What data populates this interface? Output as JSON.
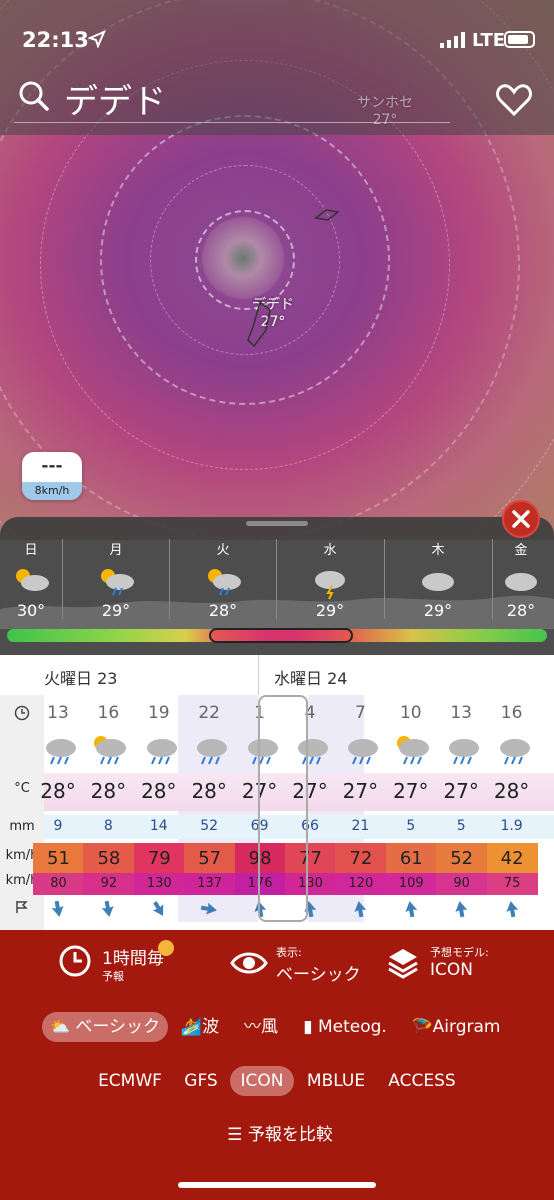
{
  "status": {
    "time": "22:13",
    "network": "LTE"
  },
  "search": {
    "title": "デデド"
  },
  "map": {
    "labels": [
      {
        "name": "デデド",
        "temp": "27°"
      },
      {
        "name": "サンホセ",
        "temp": "27°"
      }
    ],
    "wind_badge": {
      "value": "---",
      "unit": "8km/h"
    }
  },
  "days": [
    {
      "name": "日",
      "temp": "30°"
    },
    {
      "name": "月",
      "temp": "29°"
    },
    {
      "name": "火",
      "temp": "28°"
    },
    {
      "name": "水",
      "temp": "29°"
    },
    {
      "name": "木",
      "temp": "29°"
    },
    {
      "name": "金",
      "temp": "28°"
    }
  ],
  "detail": {
    "day1": "火曜日 23",
    "day2": "水曜日 24",
    "row_labels": {
      "temp": "°C",
      "precip": "mm",
      "wind": "km/h",
      "gust": "km/h"
    },
    "hours": [
      "13",
      "16",
      "19",
      "22",
      "1",
      "4",
      "7",
      "10",
      "13",
      "16"
    ],
    "temps": [
      "28°",
      "28°",
      "28°",
      "28°",
      "27°",
      "27°",
      "27°",
      "27°",
      "27°",
      "28°"
    ],
    "precip": [
      "9",
      "8",
      "14",
      "52",
      "69",
      "66",
      "21",
      "5",
      "5",
      "1.9"
    ],
    "wind": [
      "51",
      "58",
      "79",
      "57",
      "98",
      "77",
      "72",
      "61",
      "52",
      "42"
    ],
    "gust": [
      "80",
      "92",
      "130",
      "137",
      "176",
      "130",
      "120",
      "109",
      "90",
      "75"
    ],
    "wind_colors": [
      "#e9783d",
      "#e55b49",
      "#e0355e",
      "#e35a4a",
      "#d6295d",
      "#e04656",
      "#e3514f",
      "#e56d46",
      "#e77b3d",
      "#ed9133"
    ],
    "gust_colors": [
      "#d93a86",
      "#d6308c",
      "#d12696",
      "#cf239a",
      "#c31fa2",
      "#d12696",
      "#d1279a",
      "#d3289a",
      "#d63490",
      "#db3e82"
    ]
  },
  "bottom": {
    "interval_title": "1時間毎",
    "interval_sub": "予報",
    "display_label": "表示:",
    "display_value": "ベーシック",
    "model_label": "予想モデル:",
    "model_value": "ICON",
    "tabs": [
      "ベーシック",
      "波",
      "風",
      "Meteog.",
      "Airgram"
    ],
    "models": [
      "ECMWF",
      "GFS",
      "ICON",
      "MBLUE",
      "ACCESS"
    ],
    "compare": "予報を比較"
  }
}
